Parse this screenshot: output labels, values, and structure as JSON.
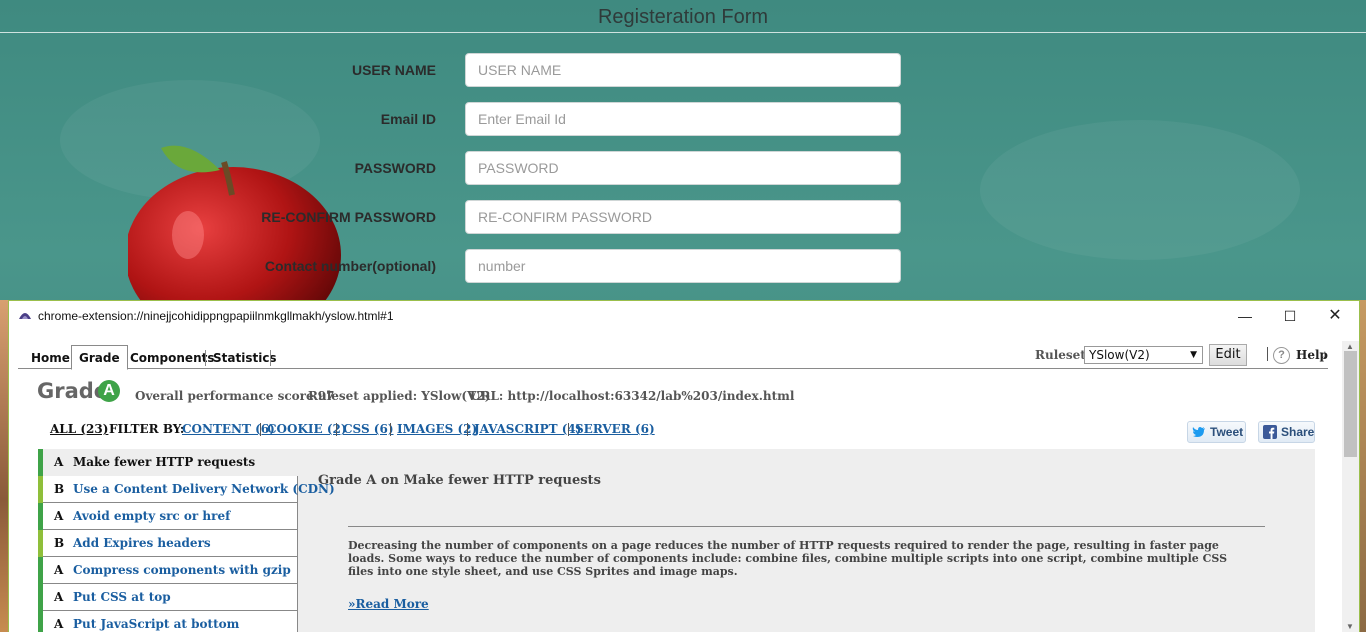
{
  "form": {
    "title": "Registeration Form",
    "fields": [
      {
        "label": "USER NAME",
        "placeholder": "USER NAME"
      },
      {
        "label": "Email ID",
        "placeholder": "Enter Email Id"
      },
      {
        "label": "PASSWORD",
        "placeholder": "PASSWORD"
      },
      {
        "label": "RE-CONFIRM PASSWORD",
        "placeholder": "RE-CONFIRM PASSWORD"
      },
      {
        "label": "Contact number(optional)",
        "placeholder": "number"
      }
    ]
  },
  "window": {
    "url": "chrome-extension://ninejjcohidippngpapiilnmkgllmakh/yslow.html#1",
    "minimize_glyph": "—",
    "maximize_glyph": "☐",
    "close_glyph": "✕"
  },
  "nav": {
    "tabs": [
      {
        "label": "Home",
        "active": false
      },
      {
        "label": "Grade",
        "active": true
      },
      {
        "label": "Components",
        "active": false
      },
      {
        "label": "Statistics",
        "active": false
      }
    ]
  },
  "toolbar": {
    "rulesets_label": "Rulesets",
    "ruleset_selected": "YSlow(V2)",
    "edit_label": "Edit",
    "help_icon": "?",
    "help_label": "Help",
    "help_arrow": "↓"
  },
  "grade": {
    "title": "Grade",
    "letter": "A",
    "score_text": "Overall performance score 97",
    "ruleset_text": "Ruleset applied: YSlow(V2)",
    "url_text": "URL: http://localhost:63342/lab%203/index.html"
  },
  "filter": {
    "all": "ALL (23)",
    "filter_by": "FILTER BY:",
    "links": [
      "CONTENT (6)",
      "COOKIE (2)",
      "CSS (6)",
      "IMAGES (2)",
      "JAVASCRIPT (4)",
      "SERVER (6)"
    ]
  },
  "social": {
    "tweet": "Tweet",
    "share": "Share"
  },
  "rules": [
    {
      "grade": "A",
      "name": "Make fewer HTTP requests"
    },
    {
      "grade": "B",
      "name": "Use a Content Delivery Network (CDN)"
    },
    {
      "grade": "A",
      "name": "Avoid empty src or href"
    },
    {
      "grade": "B",
      "name": "Add Expires headers"
    },
    {
      "grade": "A",
      "name": "Compress components with gzip"
    },
    {
      "grade": "A",
      "name": "Put CSS at top"
    },
    {
      "grade": "A",
      "name": "Put JavaScript at bottom"
    }
  ],
  "detail": {
    "title": "Grade A on Make fewer HTTP requests",
    "text": "Decreasing the number of components on a page reduces the number of HTTP requests required to render the page, resulting in faster page loads. Some ways to reduce the number of components include: combine files, combine multiple scripts into one script, combine multiple CSS files into one style sheet, and use CSS Sprites and image maps.",
    "read_more": "»Read More"
  },
  "colors": {
    "grade_a": "#3fa348",
    "grade_b": "#8fbf3a",
    "link": "#1a5ea0"
  }
}
